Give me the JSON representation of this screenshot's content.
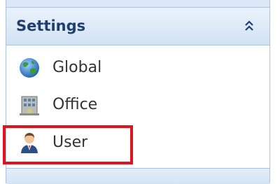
{
  "panel": {
    "title": "Settings",
    "collapse_icon": "double-chevron-up-icon",
    "items": [
      {
        "label": "Global",
        "icon": "globe-icon"
      },
      {
        "label": "Office",
        "icon": "office-building-icon"
      },
      {
        "label": "User",
        "icon": "user-icon"
      }
    ]
  },
  "colors": {
    "header_text": "#1f3f6f",
    "highlight_border": "#e0141e",
    "panel_border": "#a9c4e2"
  }
}
